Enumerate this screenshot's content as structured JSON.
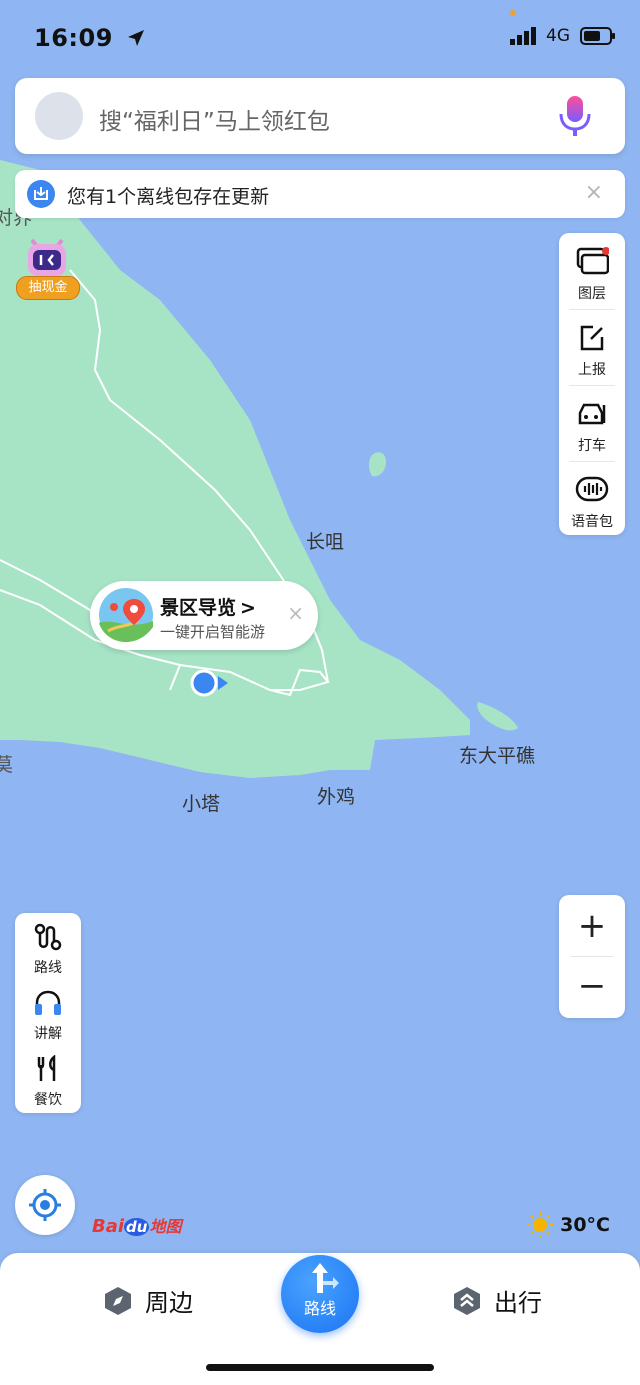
{
  "status_bar": {
    "time": "16:09",
    "network": "4G"
  },
  "search": {
    "placeholder": "搜“福利日”马上领红包"
  },
  "banner": {
    "text": "您有1个离线包存在更新",
    "close": "×"
  },
  "promo": {
    "label": "抽现金"
  },
  "right_tools": [
    {
      "label": "图层",
      "icon": "layers-icon"
    },
    {
      "label": "上报",
      "icon": "report-edit-icon"
    },
    {
      "label": "打车",
      "icon": "taxi-icon"
    },
    {
      "label": "语音包",
      "icon": "voice-pack-icon"
    }
  ],
  "left_tools": [
    {
      "label": "路线",
      "icon": "route-icon"
    },
    {
      "label": "讲解",
      "icon": "headphones-icon"
    },
    {
      "label": "餐饮",
      "icon": "fork-knife-icon"
    }
  ],
  "zoom": {
    "in": "+",
    "out": "−"
  },
  "callout": {
    "title": "景区导览",
    "arrow": ">",
    "subtitle": "一键开启智能游",
    "close": "×"
  },
  "map_labels": {
    "changju": "长咀",
    "dongdapingjiao": "东大平礁",
    "xiaota": "小塔",
    "waiji": "外鸡",
    "edge_left_top": "对界",
    "edge_left_mid": "莫"
  },
  "brand": {
    "logo_text_1": "Bai",
    "logo_text_2": "du",
    "logo_text_3": "地图"
  },
  "weather": {
    "temp": "30°C",
    "icon": "sun-icon"
  },
  "bottom_nav": {
    "nearby": "周边",
    "route": "路线",
    "travel": "出行"
  },
  "colors": {
    "sea": "#8fb6f2",
    "land": "#a7e4c6",
    "accent": "#1a74f2"
  }
}
